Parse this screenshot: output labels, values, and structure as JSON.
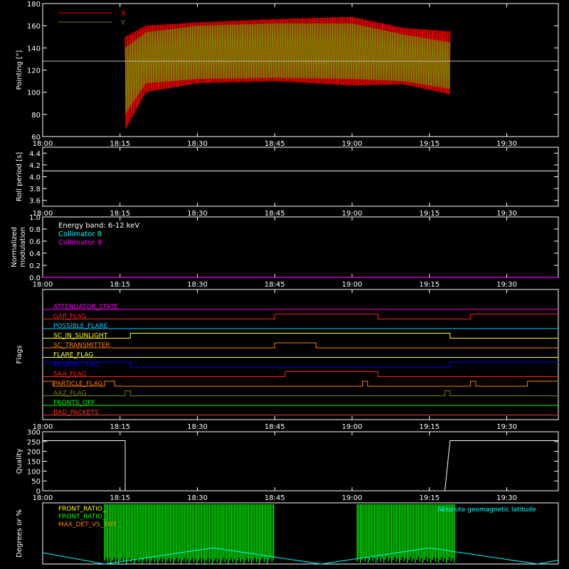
{
  "chart_data": [
    {
      "id": "pointing",
      "type": "line",
      "ylabel": "Pointing [\"]",
      "ylim": [
        60,
        180
      ],
      "yticks": [
        60,
        80,
        100,
        120,
        140,
        160,
        180
      ],
      "xlim": [
        "18:00",
        "19:40"
      ],
      "xticks": [
        "18:00",
        "18:15",
        "18:30",
        "18:45",
        "19:00",
        "19:15",
        "19:30"
      ],
      "reference_y": 128,
      "legend": [
        {
          "name": "X",
          "color": "#ff0000"
        },
        {
          "name": "Y",
          "color": "#808000"
        }
      ],
      "series": [
        {
          "name": "X",
          "color": "#ff0000",
          "x": [
            "18:16",
            "18:20",
            "18:30",
            "18:45",
            "19:00",
            "19:10",
            "19:19"
          ],
          "upper": [
            150,
            160,
            163,
            166,
            168,
            158,
            155
          ],
          "lower": [
            66,
            100,
            108,
            110,
            106,
            107,
            98
          ]
        },
        {
          "name": "Y",
          "color": "#808000",
          "x": [
            "18:16",
            "18:20",
            "18:30",
            "18:45",
            "19:00",
            "19:10",
            "19:19"
          ],
          "upper": [
            140,
            154,
            160,
            162,
            162,
            152,
            145
          ],
          "lower": [
            80,
            108,
            112,
            113,
            112,
            110,
            103
          ]
        }
      ]
    },
    {
      "id": "roll",
      "type": "line",
      "ylabel": "Roll period [s]",
      "ylim": [
        3.5,
        4.5
      ],
      "yticks": [
        3.6,
        3.8,
        4.0,
        4.2,
        4.4
      ],
      "xticks": [
        "18:00",
        "18:15",
        "18:30",
        "18:45",
        "19:00",
        "19:15",
        "19:30"
      ],
      "series": [
        {
          "name": "",
          "color": "#ffffff",
          "x": [
            "18:00",
            "19:40"
          ],
          "values": [
            4.1,
            4.1
          ]
        }
      ]
    },
    {
      "id": "modulation",
      "type": "line",
      "ylabel": "Normalized modulation",
      "ylim": [
        0,
        1
      ],
      "yticks": [
        0.0,
        0.2,
        0.4,
        0.6,
        0.8,
        1.0
      ],
      "xticks": [
        "18:00",
        "18:15",
        "18:30",
        "18:45",
        "19:00",
        "19:15",
        "19:30"
      ],
      "annotations": [
        "Energy band: 6-12 keV",
        "Collimator 8",
        "Collimator 9"
      ],
      "annotation_colors": [
        "#ffffff",
        "#00ffff",
        "#ff00ff"
      ],
      "series": [
        {
          "name": "Collimator 9",
          "color": "#ff00ff",
          "x": [
            "18:00",
            "19:40"
          ],
          "values": [
            0,
            0
          ]
        }
      ]
    },
    {
      "id": "flags",
      "type": "line",
      "ylabel": "Flags",
      "xticks": [
        "18:00",
        "18:15",
        "18:30",
        "18:45",
        "19:00",
        "19:15",
        "19:30"
      ],
      "flags": [
        {
          "name": "ATTENUATOR_STATE",
          "color": "#ff00ff",
          "transitions": [
            [
              "18:00",
              0
            ]
          ]
        },
        {
          "name": "GAP_FLAG",
          "color": "#ff2020",
          "transitions": [
            [
              "18:00",
              0
            ],
            [
              "18:12",
              0
            ],
            [
              "18:45",
              1
            ],
            [
              "19:05",
              0
            ],
            [
              "19:23",
              1
            ]
          ]
        },
        {
          "name": "POSSIBLE_FLARE",
          "color": "#00d0ff",
          "transitions": [
            [
              "18:00",
              0
            ]
          ]
        },
        {
          "name": "SC_IN_SUNLIGHT",
          "color": "#ffff00",
          "transitions": [
            [
              "18:00",
              0
            ],
            [
              "18:17",
              1
            ],
            [
              "19:19",
              0
            ]
          ]
        },
        {
          "name": "SC_TRANSMITTER",
          "color": "#ff7f00",
          "transitions": [
            [
              "18:00",
              0
            ],
            [
              "18:45",
              1
            ],
            [
              "18:53",
              0
            ]
          ]
        },
        {
          "name": "FLARE_FLAG",
          "color": "#ffff40",
          "transitions": [
            [
              "18:00",
              0
            ]
          ]
        },
        {
          "name": "ECLIPSE_FLAG",
          "color": "#0000ff",
          "transitions": [
            [
              "18:00",
              1
            ],
            [
              "18:17",
              0
            ],
            [
              "19:19",
              1
            ]
          ]
        },
        {
          "name": "SAA_FLAG",
          "color": "#ff2020",
          "transitions": [
            [
              "18:00",
              0
            ],
            [
              "18:47",
              1
            ],
            [
              "19:05",
              0
            ]
          ]
        },
        {
          "name": "PARTICLE_FLAG",
          "color": "#ff7f00",
          "transitions": [
            [
              "18:00",
              1
            ],
            [
              "18:02",
              0
            ],
            [
              "18:12",
              1
            ],
            [
              "18:14",
              0
            ],
            [
              "19:02",
              1
            ],
            [
              "19:03",
              0
            ],
            [
              "19:23",
              1
            ],
            [
              "19:24",
              0
            ],
            [
              "19:34",
              1
            ],
            [
              "19:40",
              1
            ]
          ]
        },
        {
          "name": "AAZ_FLAG",
          "color": "#808000",
          "transitions": [
            [
              "18:00",
              0
            ],
            [
              "18:16",
              1
            ],
            [
              "18:17",
              0
            ],
            [
              "19:18",
              1
            ],
            [
              "19:19",
              0
            ]
          ]
        },
        {
          "name": "FRONTS_OFF",
          "color": "#00ff00",
          "transitions": [
            [
              "18:00",
              0
            ]
          ]
        },
        {
          "name": "BAD_PACKETS",
          "color": "#ff3030",
          "transitions": [
            [
              "18:00",
              0
            ]
          ]
        }
      ]
    },
    {
      "id": "quality",
      "type": "line",
      "ylabel": "Quality",
      "ylim": [
        0,
        300
      ],
      "yticks": [
        0,
        50,
        100,
        150,
        200,
        250,
        300
      ],
      "xticks": [
        "18:00",
        "18:15",
        "18:30",
        "18:45",
        "19:00",
        "19:15",
        "19:30"
      ],
      "series": [
        {
          "name": "",
          "color": "#ffffff",
          "x": [
            "18:00",
            "18:16",
            "18:16",
            "19:18",
            "19:19",
            "19:40"
          ],
          "values": [
            255,
            255,
            0,
            0,
            255,
            255
          ]
        }
      ]
    },
    {
      "id": "degrees",
      "type": "line",
      "ylabel": "Degrees or %",
      "ylim": [
        0,
        100
      ],
      "legend": [
        {
          "name": "FRONT_RATIO_",
          "color": "#ffff00"
        },
        {
          "name": "FRONT_RATIO_",
          "color": "#00ff00"
        },
        {
          "name": "MAX_DET_VS_TOT",
          "color": "#ff7f00"
        },
        {
          "name": "Absolute geomagnetic latitude",
          "color": "#00ffff"
        }
      ],
      "green_bands": [
        [
          "18:12",
          "18:45"
        ],
        [
          "19:01",
          "19:20"
        ]
      ],
      "series": [
        {
          "name": "Absolute geomagnetic latitude",
          "color": "#00ffff",
          "x": [
            "18:00",
            "18:12",
            "18:33",
            "18:54",
            "19:15",
            "19:36",
            "19:40"
          ],
          "values": [
            23,
            0,
            33,
            0,
            33,
            0,
            8
          ]
        }
      ]
    }
  ]
}
